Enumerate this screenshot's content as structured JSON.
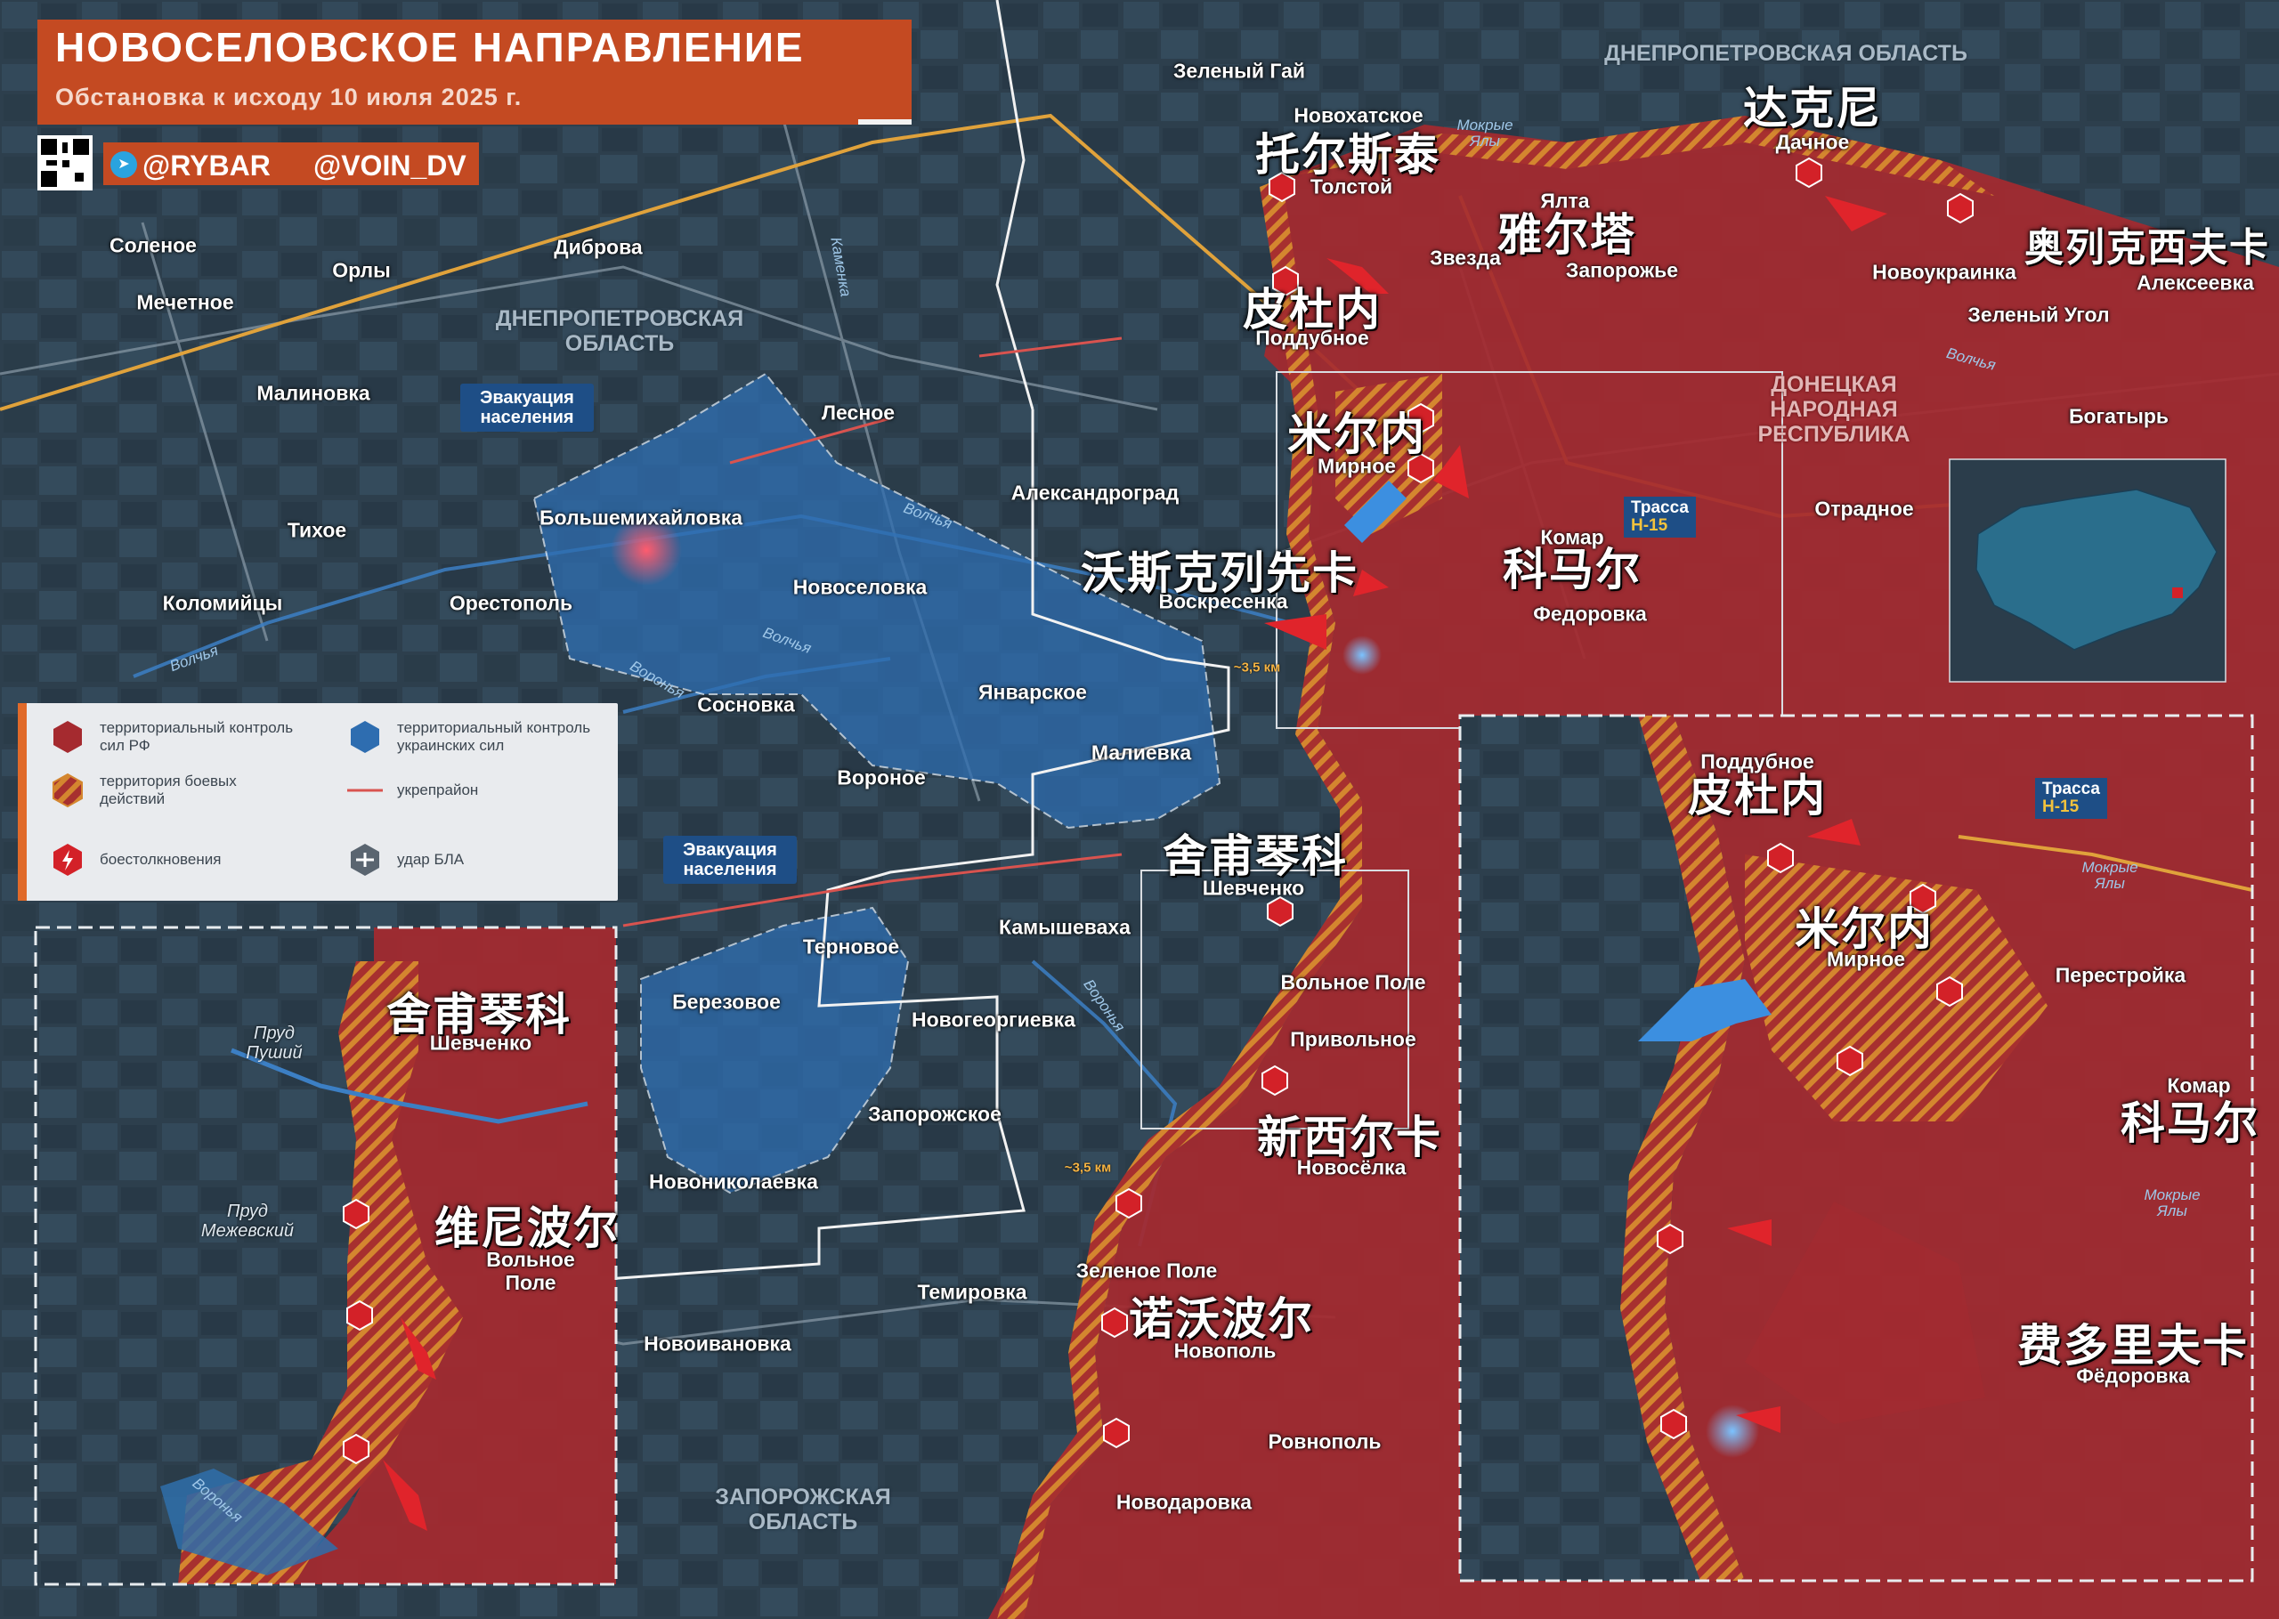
{
  "header": {
    "title": "НОВОСЕЛОВСКОЕ НАПРАВЛЕНИЕ",
    "subtitle": "Обстановка к исходу 10 июля 2025 г.",
    "handle_rybar": "@RYBAR",
    "handle_voin": "@VOIN_DV"
  },
  "colors": {
    "ru_control": "#a52a2f",
    "ua_control": "#2e6db0",
    "combat_zone": "#d4862f",
    "header_orange": "#c44a22",
    "map_background": "#2c3e4c"
  },
  "legend": {
    "ru_control": "территориальный контроль сил РФ",
    "ua_control": "территориальный контроль украинских сил",
    "combat_zone": "территория боевых действий",
    "fortified": "укрепрайон",
    "clashes": "боестолкновения",
    "uav_strike": "удар БЛА",
    "icons": [
      "red-hexagon-icon",
      "blue-hexagon-icon",
      "hatched-hexagon-icon",
      "red-line-icon",
      "clash-icon",
      "drone-strike-icon"
    ]
  },
  "regions": {
    "dnepr_top": "ДНЕПРОПЕТРОВСКАЯ ОБЛАСТЬ",
    "dnepr_mid": "ДНЕПРОПЕТРОВСКАЯ ОБЛАСТЬ",
    "dnr": "ДОНЕЦКАЯ НАРОДНАЯ РЕСПУБЛИКА",
    "zaporozhye": "ЗАПОРОЖСКАЯ ОБЛАСТЬ"
  },
  "evacuation": {
    "label_1": "Эвакуация населения",
    "label_2": "Эвакуация населения"
  },
  "road": {
    "label": "Трасса",
    "code": "Н-15"
  },
  "distance": {
    "d1": "~3,5 км",
    "d2": "~3,5 км"
  },
  "towns": {
    "zeleny_gai": "Зеленый Гай",
    "novokhatskoe": "Новохатское",
    "tolstoy": "Толстой",
    "dachnoe": "Дачное",
    "yalta": "Ялта",
    "zvezda": "Звезда",
    "zaporozhye": "Запорожье",
    "novoukrainka": "Новоукраинка",
    "alekseevka": "Алексеевка",
    "zeleny_ugol": "Зеленый Угол",
    "poddubnoe": "Поддубное",
    "bogatyr": "Богатырь",
    "mirnoe": "Мирное",
    "otradnoe": "Отрадное",
    "komar": "Комар",
    "fedorovka": "Федоровка",
    "voskresenka": "Воскресенка",
    "solenoe": "Соленое",
    "orly": "Орлы",
    "dibrova": "Диброва",
    "mechetnoe": "Мечетное",
    "malinovka": "Малиновка",
    "lesnoe": "Лесное",
    "bolshemikhailovka": "Большемихайловка",
    "aleksandrograd": "Александроград",
    "tikhoe": "Тихое",
    "kolomiytsy": "Коломийцы",
    "orestopol": "Орестополь",
    "novoselovka": "Новоселовка",
    "yanvarskoe": "Январское",
    "sosnovka": "Сосновка",
    "malievka": "Малиевка",
    "voronoe": "Вороное",
    "shevchenko": "Шевченко",
    "ternovoe": "Терновое",
    "kamyshevakha": "Камышеваха",
    "volnoe_pole": "Вольное Поле",
    "berezovoe": "Березовое",
    "novogeorgievka": "Новогеоргиевка",
    "privolnoe": "Привольное",
    "zaporozhskoe": "Запорожское",
    "novoselka": "Новосёлка",
    "novonikolaevka": "Новониколаевка",
    "zelenoe_pole": "Зеленое Поле",
    "temirovka": "Темировка",
    "novoivanovka": "Новоивановка",
    "novopol": "Новополь",
    "rovnopol": "Ровнополь",
    "novodarovka": "Новодаровка"
  },
  "chinese": {
    "tolstoy": "托尔斯泰",
    "dachnoe": "达克尼",
    "yalta": "雅尔塔",
    "novoukrainka": "奥列克西夫卡",
    "poddubnoe": "皮杜内",
    "mirnoe": "米尔内",
    "voskresenka": "沃斯克列先卡",
    "komar": "科马尔",
    "shevchenko": "舍甫琴科",
    "novoselka": "新西尔卡",
    "novopol": "诺沃波尔"
  },
  "rivers": {
    "kamenka": "Каменка",
    "volchya_1": "Волчья",
    "volchya_2": "Волчья",
    "volchya_3": "Волчья",
    "volchya_4": "Волчья",
    "voronaya_1": "Воронья",
    "voronaya_2": "Воронья",
    "mokrye_yaly": "Мокрые Ялы"
  },
  "inset_left": {
    "shevchenko": "Шевченко",
    "shevchenko_cn": "舍甫琴科",
    "volnoe_pole": "Вольное Поле",
    "volnoe_pole_cn": "维尼波尔",
    "prud_pushiy": "Пруд Пуший",
    "prud_mezhevsky": "Пруд Межевский",
    "voronaya": "Воронья"
  },
  "inset_right": {
    "poddubnoe": "Поддубное",
    "poddubnoe_cn": "皮杜内",
    "mirnoe": "Мирное",
    "mirnoe_cn": "米尔内",
    "perestroika": "Перестройка",
    "komar": "Комар",
    "komar_cn": "科马尔",
    "fedorovka": "Фёдоровка",
    "fedorovka_cn": "费多里夫卡",
    "mokrye_yaly_1": "Мокрые Ялы",
    "mokrye_yaly_2": "Мокрые Ялы",
    "road_label": "Трасса",
    "road_code": "Н-15"
  }
}
